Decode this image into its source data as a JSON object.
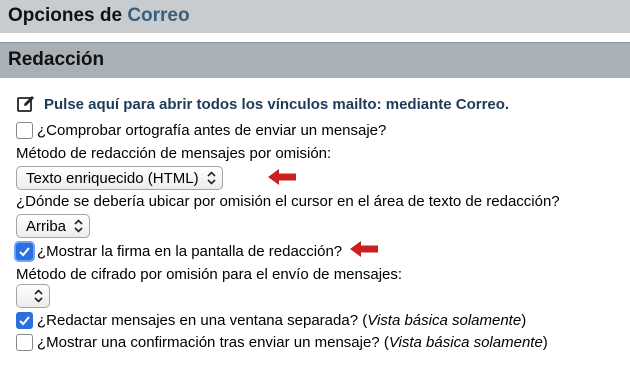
{
  "header": {
    "title_prefix": "Opciones de",
    "title_accent": "Correo"
  },
  "section": {
    "title": "Redacción"
  },
  "mailto": {
    "link_text": "Pulse aquí para abrir todos los vínculos mailto: mediante Correo.",
    "icon": "edit-icon"
  },
  "options": {
    "spellcheck": {
      "label": "¿Comprobar ortografía antes de enviar un mensaje?",
      "checked": false
    },
    "compose_method": {
      "label": "Método de redacción de mensajes por omisión:",
      "selected": "Texto enriquecido (HTML)"
    },
    "cursor_position": {
      "label": "¿Dónde se debería ubicar por omisión el cursor en el área de texto de redacción?",
      "selected": "Arriba"
    },
    "show_signature": {
      "label": "¿Mostrar la firma en la pantalla de redacción?",
      "checked": true
    },
    "encryption_method": {
      "label": "Método de cifrado por omisión para el envío de mensajes:",
      "selected": ""
    },
    "separate_window": {
      "label": "¿Redactar mensajes en una ventana separada? (",
      "label_em": "Vista básica solamente",
      "label_end": ")",
      "checked": true
    },
    "send_confirmation": {
      "label": "¿Mostrar una confirmación tras enviar un mensaje? (",
      "label_em": "Vista básica solamente",
      "label_end": ")",
      "checked": false
    }
  },
  "colors": {
    "annotation_arrow": "#cc1f1f",
    "checkbox_checked": "#2c6fdf",
    "link": "#1f3b57"
  }
}
